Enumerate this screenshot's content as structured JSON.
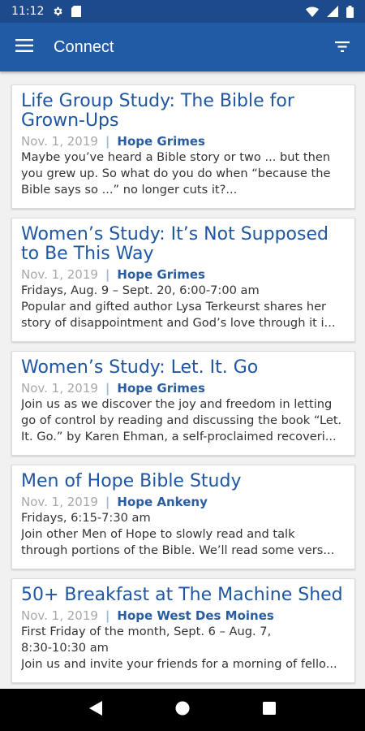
{
  "status_bar": {
    "time": "11:12"
  },
  "app_bar": {
    "title": "Connect",
    "colors": {
      "status": "#1d4a8b",
      "toolbar": "#215ba6",
      "accent": "#1f56a1"
    }
  },
  "cards": [
    {
      "title": "Life Group Study: The Bible for Grown-Ups",
      "date": "Nov. 1, 2019",
      "location": "Hope Grimes",
      "lines": [
        "Maybe you’ve heard a Bible story or two ... but then",
        "you grew up. So what do you do when “because the",
        "Bible says so ...” no longer cuts it?..."
      ]
    },
    {
      "title": "Women’s Study: It’s Not Supposed to Be This Way",
      "date": "Nov. 1, 2019",
      "location": "Hope Grimes",
      "lines": [
        "Fridays, Aug. 9 – Sept. 20, 6:00-7:00 am",
        "Popular and gifted author Lysa Terkeurst shares her",
        "story of disappointment and God’s love through it i..."
      ]
    },
    {
      "title": "Women’s Study: Let. It. Go",
      "date": "Nov. 1, 2019",
      "location": "Hope Grimes",
      "lines": [
        "Join us as we discover the joy and freedom in letting",
        "go of control by reading and discussing the book “Let.",
        "It. Go.” by Karen Ehman, a self-proclaimed recoveri..."
      ]
    },
    {
      "title": "Men of Hope Bible Study",
      "date": "Nov. 1, 2019",
      "location": "Hope Ankeny",
      "lines": [
        "Fridays, 6:15-7:30 am",
        "Join other Men of Hope to slowly read and talk",
        "through portions of the Bible. We’ll read some vers..."
      ]
    },
    {
      "title": "50+ Breakfast at The Machine Shed",
      "date": "Nov. 1, 2019",
      "location": "Hope West Des Moines",
      "lines": [
        "First Friday of the month, Sept. 6 – Aug. 7,",
        "8:30-10:30 am",
        "Join us and invite your friends for a morning of fello..."
      ]
    }
  ]
}
